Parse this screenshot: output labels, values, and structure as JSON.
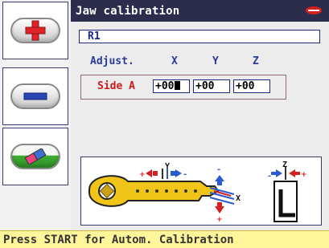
{
  "window": {
    "title": "Jaw calibration"
  },
  "sidebar": {
    "buttons": [
      {
        "icon": "plus-icon"
      },
      {
        "icon": "minus-icon"
      },
      {
        "icon": "eraser-icon"
      }
    ]
  },
  "form": {
    "name_value": "R1",
    "columns": {
      "adjust": "Adjust.",
      "x": "X",
      "y": "Y",
      "z": "Z"
    },
    "side_label": "Side A",
    "values": {
      "x": "+00",
      "y": "+00",
      "z": "+00"
    }
  },
  "diagram": {
    "labels": {
      "y": "Y",
      "x": "X",
      "z": "Z"
    },
    "icons": [
      "key-icon",
      "jaw-icon"
    ]
  },
  "status": {
    "text": "Press START for Autom. Calibration"
  },
  "colors": {
    "title_bar": "#2c2c4c",
    "accent_blue": "#2a3a9a",
    "side_red": "#cc1a1a",
    "key_yellow": "#f0c419",
    "status_bg": "#fff59a"
  }
}
